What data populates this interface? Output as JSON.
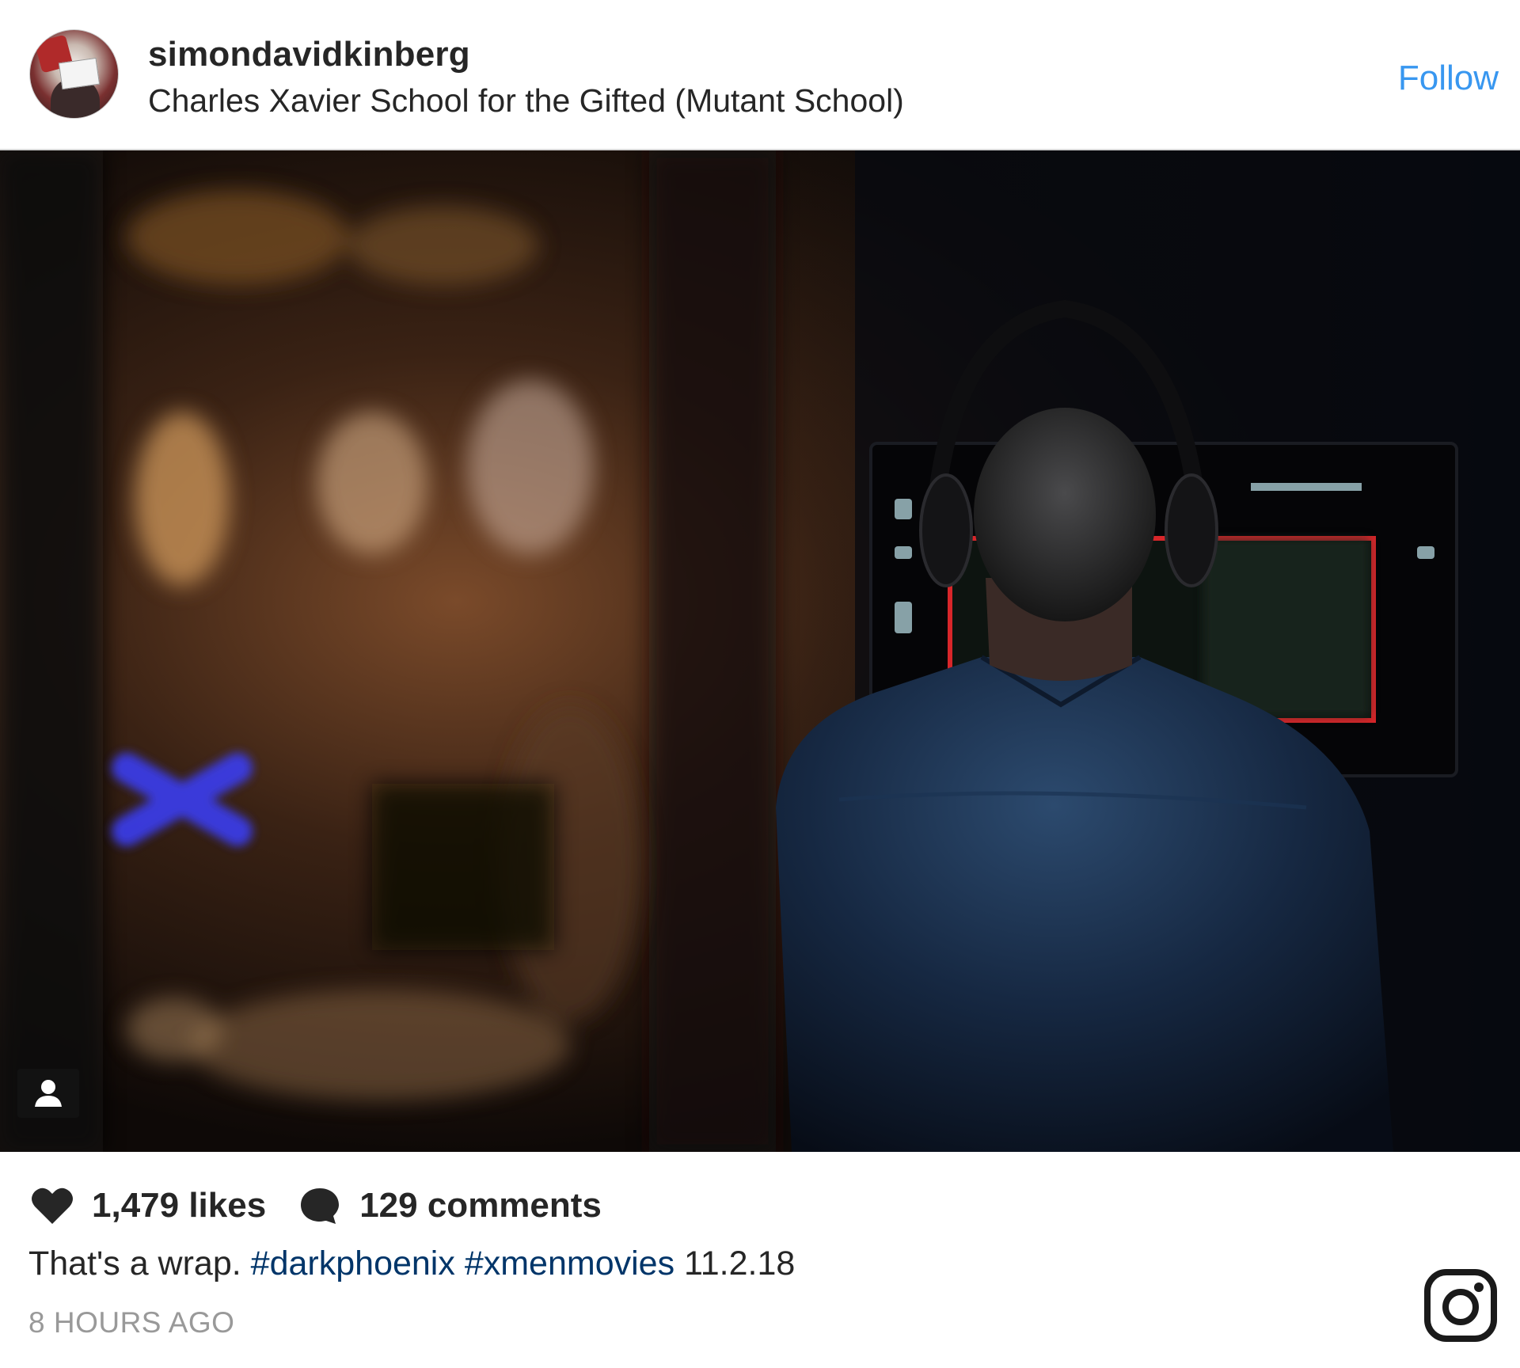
{
  "header": {
    "username": "simondavidkinberg",
    "location": "Charles Xavier School for the Gifted (Mutant School)",
    "follow_label": "Follow"
  },
  "photo": {
    "icons": {
      "tag": "person-tag-icon"
    }
  },
  "footer": {
    "likes": "1,479 likes",
    "comments": "129 comments",
    "caption_text": "That's a wrap.",
    "hashtag_1": "#darkphoenix",
    "hashtag_2": "#xmenmovies",
    "caption_date": "11.2.18",
    "timestamp": "8 HOURS AGO",
    "icons": {
      "like": "heart-icon",
      "comment": "comment-bubble-icon",
      "brand": "instagram-logo-icon"
    }
  },
  "colors": {
    "link": "#3897f0",
    "hashtag": "#003569",
    "text": "#262626",
    "muted": "#999999"
  }
}
